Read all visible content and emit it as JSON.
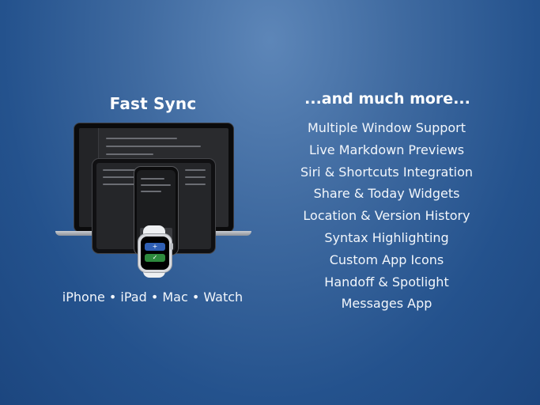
{
  "left": {
    "title": "Fast Sync",
    "platforms": "iPhone • iPad • Mac • Watch"
  },
  "right": {
    "title": "...and much more...",
    "features": [
      "Multiple Window Support",
      "Live Markdown Previews",
      "Siri & Shortcuts Integration",
      "Share & Today Widgets",
      "Location & Version History",
      "Syntax Highlighting",
      "Custom App Icons",
      "Handoff & Spotlight",
      "Messages App"
    ]
  },
  "devices": {
    "watch_add_glyph": "+",
    "watch_mark_glyph": "✓",
    "colors": {
      "watch_add": "#2f5fb4",
      "watch_mark": "#2d8a3d",
      "background_top": "#5d86b8",
      "background_bottom": "#1c467f"
    }
  }
}
